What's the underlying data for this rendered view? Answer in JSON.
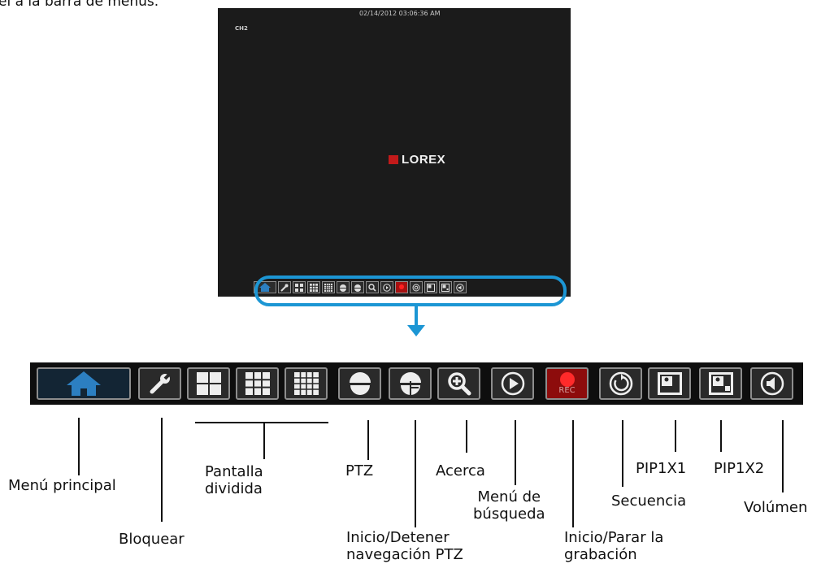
{
  "caption": "el a la barra de menus.",
  "monitor": {
    "timestamp": "02/14/2012 03:06:36 AM",
    "channel": "CH2",
    "logo_text": "LOREX"
  },
  "colors": {
    "accent": "#1c96d4",
    "rec": "#a71111",
    "home_icon": "#2c7fc1"
  },
  "toolbar_icons": [
    "home-icon",
    "wrench-icon",
    "split-4-icon",
    "split-9-icon",
    "split-16-icon",
    "ptz-camera-icon",
    "ptz-navigation-icon",
    "zoom-icon",
    "play-icon",
    "record-icon",
    "sequence-icon",
    "pip-1x1-icon",
    "pip-1x2-icon",
    "volume-icon"
  ],
  "rec_label": "REC",
  "labels": {
    "menu_principal": "Menú principal",
    "bloquear": "Bloquear",
    "pantalla_dividida": [
      "Pantalla",
      "dividida"
    ],
    "ptz": "PTZ",
    "ptz_nav": [
      "Inicio/Detener",
      "navegación PTZ"
    ],
    "acerca": "Acerca",
    "menu_busqueda": [
      "Menú de",
      "búsqueda"
    ],
    "rec_toggle": [
      "Inicio/Parar la",
      "grabación"
    ],
    "secuencia": "Secuencia",
    "pip1x1": "PIP1X1",
    "pip1x2": "PIP1X2",
    "volumen": "Volúmen"
  }
}
